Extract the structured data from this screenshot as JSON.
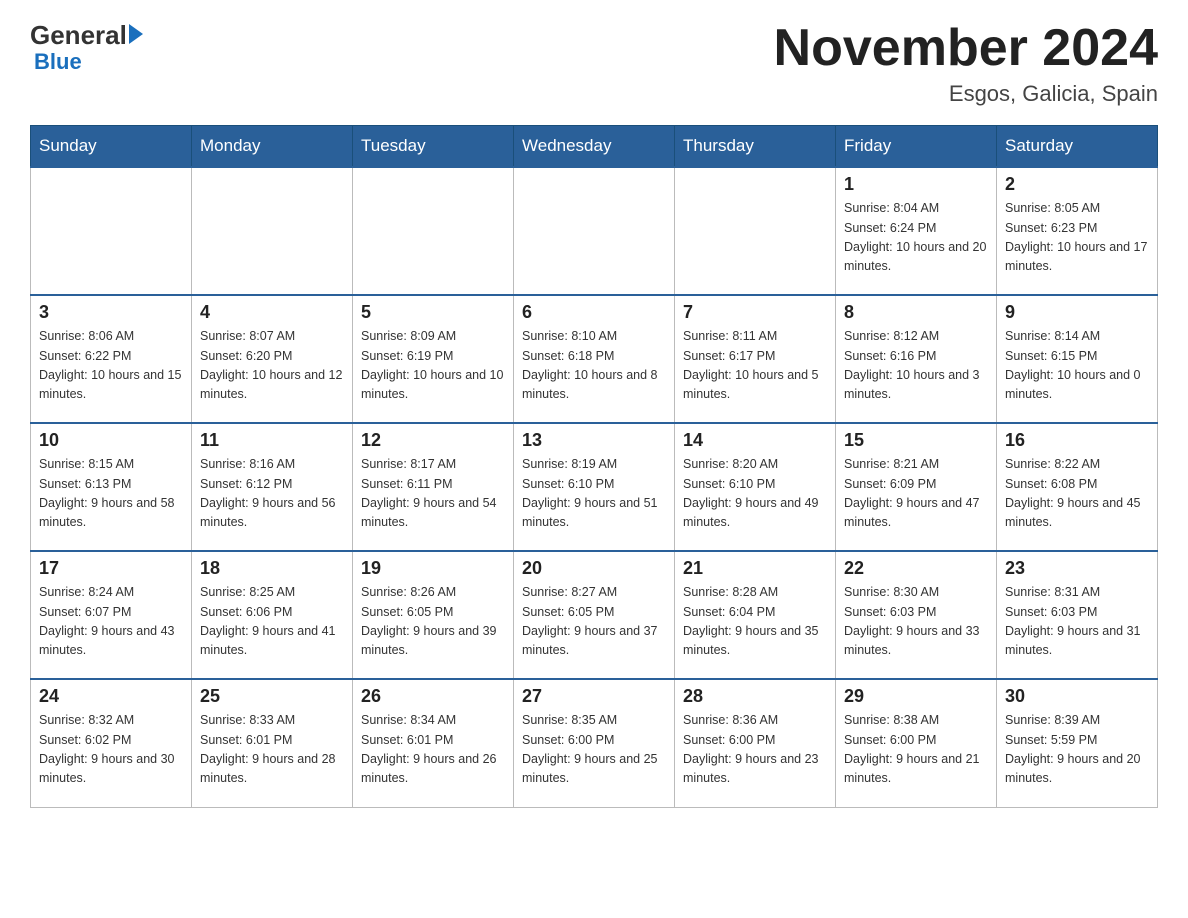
{
  "header": {
    "logo_general": "General",
    "logo_blue": "Blue",
    "month_title": "November 2024",
    "location": "Esgos, Galicia, Spain"
  },
  "weekdays": [
    "Sunday",
    "Monday",
    "Tuesday",
    "Wednesday",
    "Thursday",
    "Friday",
    "Saturday"
  ],
  "weeks": [
    [
      {
        "day": "",
        "sunrise": "",
        "sunset": "",
        "daylight": ""
      },
      {
        "day": "",
        "sunrise": "",
        "sunset": "",
        "daylight": ""
      },
      {
        "day": "",
        "sunrise": "",
        "sunset": "",
        "daylight": ""
      },
      {
        "day": "",
        "sunrise": "",
        "sunset": "",
        "daylight": ""
      },
      {
        "day": "",
        "sunrise": "",
        "sunset": "",
        "daylight": ""
      },
      {
        "day": "1",
        "sunrise": "Sunrise: 8:04 AM",
        "sunset": "Sunset: 6:24 PM",
        "daylight": "Daylight: 10 hours and 20 minutes."
      },
      {
        "day": "2",
        "sunrise": "Sunrise: 8:05 AM",
        "sunset": "Sunset: 6:23 PM",
        "daylight": "Daylight: 10 hours and 17 minutes."
      }
    ],
    [
      {
        "day": "3",
        "sunrise": "Sunrise: 8:06 AM",
        "sunset": "Sunset: 6:22 PM",
        "daylight": "Daylight: 10 hours and 15 minutes."
      },
      {
        "day": "4",
        "sunrise": "Sunrise: 8:07 AM",
        "sunset": "Sunset: 6:20 PM",
        "daylight": "Daylight: 10 hours and 12 minutes."
      },
      {
        "day": "5",
        "sunrise": "Sunrise: 8:09 AM",
        "sunset": "Sunset: 6:19 PM",
        "daylight": "Daylight: 10 hours and 10 minutes."
      },
      {
        "day": "6",
        "sunrise": "Sunrise: 8:10 AM",
        "sunset": "Sunset: 6:18 PM",
        "daylight": "Daylight: 10 hours and 8 minutes."
      },
      {
        "day": "7",
        "sunrise": "Sunrise: 8:11 AM",
        "sunset": "Sunset: 6:17 PM",
        "daylight": "Daylight: 10 hours and 5 minutes."
      },
      {
        "day": "8",
        "sunrise": "Sunrise: 8:12 AM",
        "sunset": "Sunset: 6:16 PM",
        "daylight": "Daylight: 10 hours and 3 minutes."
      },
      {
        "day": "9",
        "sunrise": "Sunrise: 8:14 AM",
        "sunset": "Sunset: 6:15 PM",
        "daylight": "Daylight: 10 hours and 0 minutes."
      }
    ],
    [
      {
        "day": "10",
        "sunrise": "Sunrise: 8:15 AM",
        "sunset": "Sunset: 6:13 PM",
        "daylight": "Daylight: 9 hours and 58 minutes."
      },
      {
        "day": "11",
        "sunrise": "Sunrise: 8:16 AM",
        "sunset": "Sunset: 6:12 PM",
        "daylight": "Daylight: 9 hours and 56 minutes."
      },
      {
        "day": "12",
        "sunrise": "Sunrise: 8:17 AM",
        "sunset": "Sunset: 6:11 PM",
        "daylight": "Daylight: 9 hours and 54 minutes."
      },
      {
        "day": "13",
        "sunrise": "Sunrise: 8:19 AM",
        "sunset": "Sunset: 6:10 PM",
        "daylight": "Daylight: 9 hours and 51 minutes."
      },
      {
        "day": "14",
        "sunrise": "Sunrise: 8:20 AM",
        "sunset": "Sunset: 6:10 PM",
        "daylight": "Daylight: 9 hours and 49 minutes."
      },
      {
        "day": "15",
        "sunrise": "Sunrise: 8:21 AM",
        "sunset": "Sunset: 6:09 PM",
        "daylight": "Daylight: 9 hours and 47 minutes."
      },
      {
        "day": "16",
        "sunrise": "Sunrise: 8:22 AM",
        "sunset": "Sunset: 6:08 PM",
        "daylight": "Daylight: 9 hours and 45 minutes."
      }
    ],
    [
      {
        "day": "17",
        "sunrise": "Sunrise: 8:24 AM",
        "sunset": "Sunset: 6:07 PM",
        "daylight": "Daylight: 9 hours and 43 minutes."
      },
      {
        "day": "18",
        "sunrise": "Sunrise: 8:25 AM",
        "sunset": "Sunset: 6:06 PM",
        "daylight": "Daylight: 9 hours and 41 minutes."
      },
      {
        "day": "19",
        "sunrise": "Sunrise: 8:26 AM",
        "sunset": "Sunset: 6:05 PM",
        "daylight": "Daylight: 9 hours and 39 minutes."
      },
      {
        "day": "20",
        "sunrise": "Sunrise: 8:27 AM",
        "sunset": "Sunset: 6:05 PM",
        "daylight": "Daylight: 9 hours and 37 minutes."
      },
      {
        "day": "21",
        "sunrise": "Sunrise: 8:28 AM",
        "sunset": "Sunset: 6:04 PM",
        "daylight": "Daylight: 9 hours and 35 minutes."
      },
      {
        "day": "22",
        "sunrise": "Sunrise: 8:30 AM",
        "sunset": "Sunset: 6:03 PM",
        "daylight": "Daylight: 9 hours and 33 minutes."
      },
      {
        "day": "23",
        "sunrise": "Sunrise: 8:31 AM",
        "sunset": "Sunset: 6:03 PM",
        "daylight": "Daylight: 9 hours and 31 minutes."
      }
    ],
    [
      {
        "day": "24",
        "sunrise": "Sunrise: 8:32 AM",
        "sunset": "Sunset: 6:02 PM",
        "daylight": "Daylight: 9 hours and 30 minutes."
      },
      {
        "day": "25",
        "sunrise": "Sunrise: 8:33 AM",
        "sunset": "Sunset: 6:01 PM",
        "daylight": "Daylight: 9 hours and 28 minutes."
      },
      {
        "day": "26",
        "sunrise": "Sunrise: 8:34 AM",
        "sunset": "Sunset: 6:01 PM",
        "daylight": "Daylight: 9 hours and 26 minutes."
      },
      {
        "day": "27",
        "sunrise": "Sunrise: 8:35 AM",
        "sunset": "Sunset: 6:00 PM",
        "daylight": "Daylight: 9 hours and 25 minutes."
      },
      {
        "day": "28",
        "sunrise": "Sunrise: 8:36 AM",
        "sunset": "Sunset: 6:00 PM",
        "daylight": "Daylight: 9 hours and 23 minutes."
      },
      {
        "day": "29",
        "sunrise": "Sunrise: 8:38 AM",
        "sunset": "Sunset: 6:00 PM",
        "daylight": "Daylight: 9 hours and 21 minutes."
      },
      {
        "day": "30",
        "sunrise": "Sunrise: 8:39 AM",
        "sunset": "Sunset: 5:59 PM",
        "daylight": "Daylight: 9 hours and 20 minutes."
      }
    ]
  ]
}
